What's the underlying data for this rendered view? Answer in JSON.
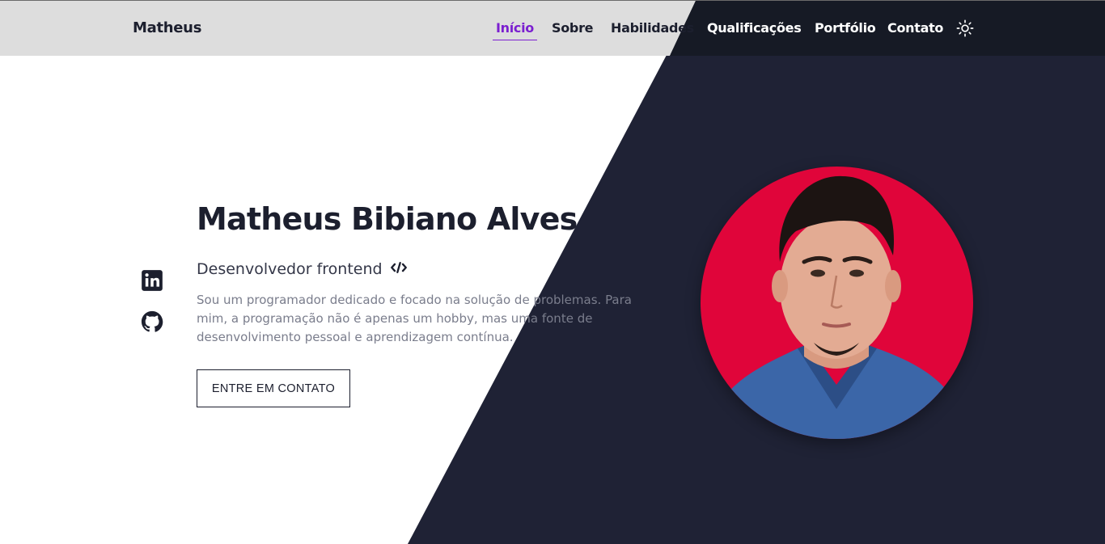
{
  "header": {
    "logo": "Matheus",
    "nav": [
      {
        "label": "Início",
        "active": true
      },
      {
        "label": "Sobre"
      },
      {
        "label": "Habilidades"
      },
      {
        "label": "Qualificações"
      },
      {
        "label": "Portfólio"
      },
      {
        "label": "Contato"
      }
    ],
    "theme_icon": "sun-icon"
  },
  "hero": {
    "name": "Matheus Bibiano Alves",
    "subtitle": "Desenvolvedor frontend",
    "subtitle_icon": "code-icon",
    "description": "Sou um programador dedicado e focado na solução de problemas. Para mim, a programação não é apenas um hobby, mas uma fonte de desenvolvimento pessoal e aprendizagem contínua.",
    "cta_label": "ENTRE EM CONTATO",
    "social_icons": [
      "linkedin-icon",
      "github-icon"
    ]
  },
  "colors": {
    "accent": "#7b1fd0",
    "dark_bg": "#1f2235",
    "avatar_bg": "#e0053a"
  }
}
